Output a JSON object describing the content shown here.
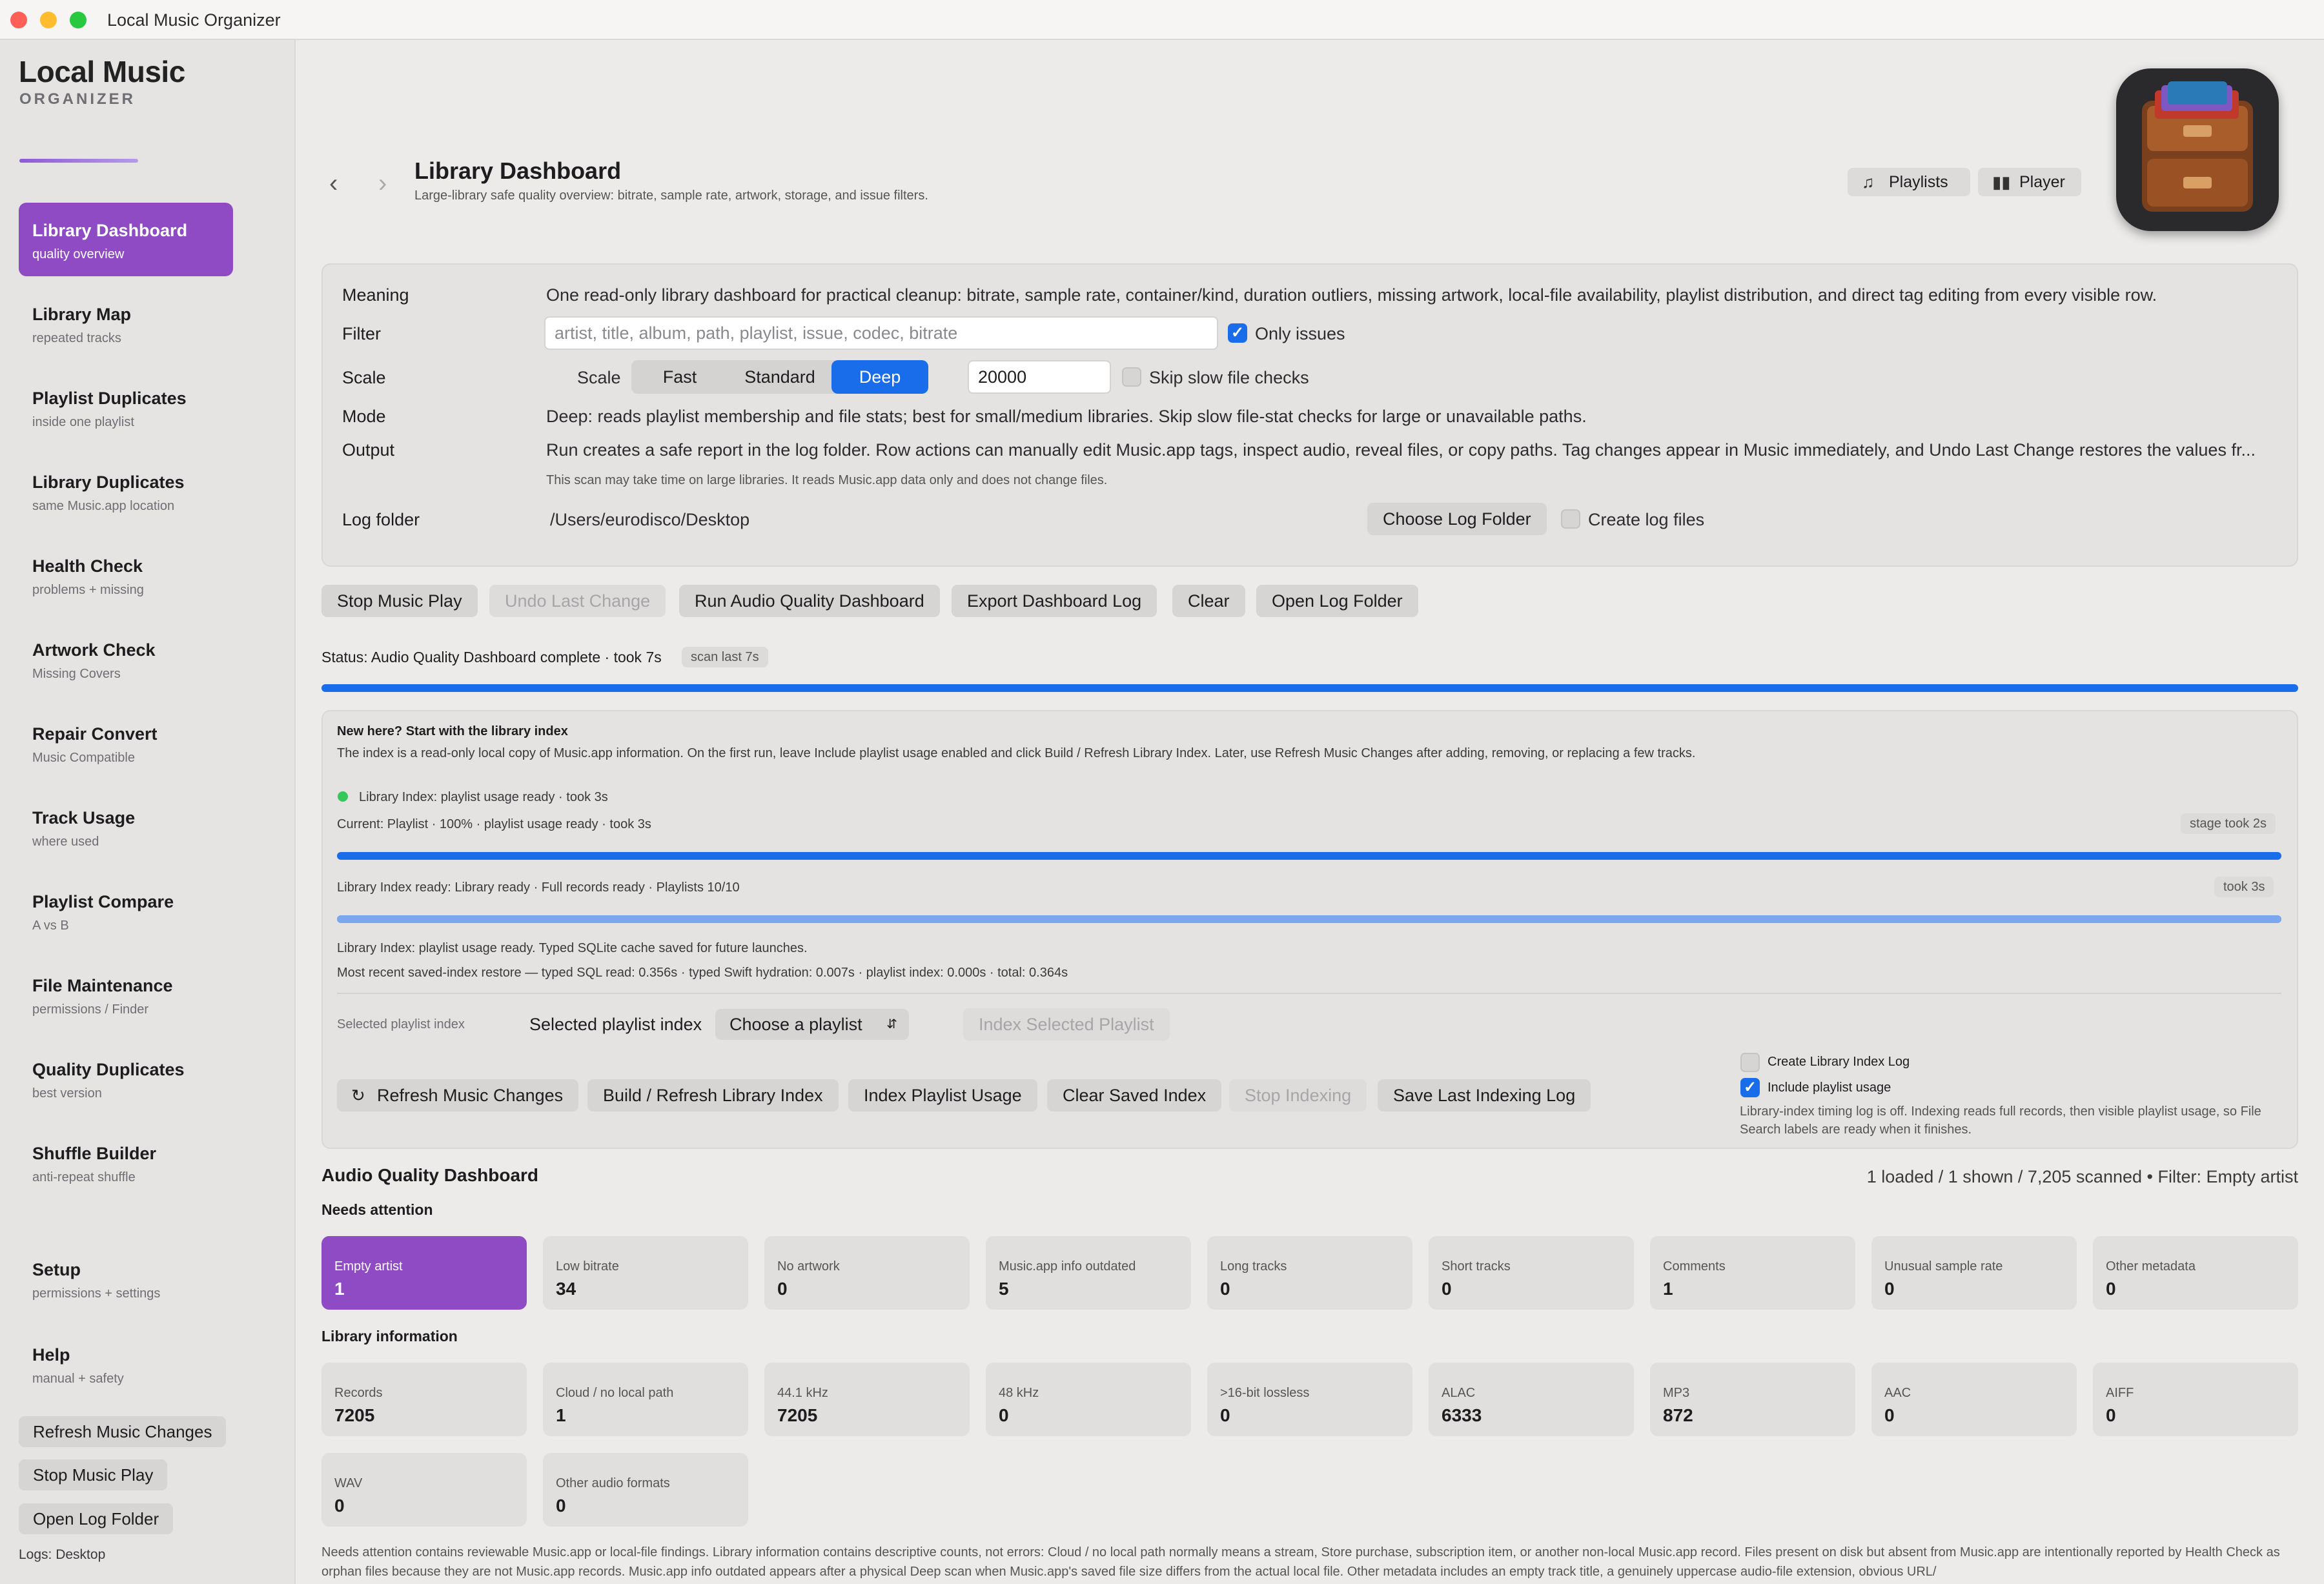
{
  "window": {
    "title": "Local Music Organizer"
  },
  "brand": {
    "line1": "Local Music",
    "line2": "ORGANIZER"
  },
  "sidebar": {
    "items": [
      {
        "title": "Library Dashboard",
        "sub": "quality overview"
      },
      {
        "title": "Library Map",
        "sub": "repeated tracks"
      },
      {
        "title": "Playlist Duplicates",
        "sub": "inside one playlist"
      },
      {
        "title": "Library Duplicates",
        "sub": "same Music.app location"
      },
      {
        "title": "Health Check",
        "sub": "problems + missing"
      },
      {
        "title": "Artwork Check",
        "sub": "Missing Covers"
      },
      {
        "title": "Repair Convert",
        "sub": "Music Compatible"
      },
      {
        "title": "Track Usage",
        "sub": "where used"
      },
      {
        "title": "Playlist Compare",
        "sub": "A vs B"
      },
      {
        "title": "File Maintenance",
        "sub": "permissions / Finder"
      },
      {
        "title": "Quality Duplicates",
        "sub": "best version"
      },
      {
        "title": "Shuffle Builder",
        "sub": "anti-repeat shuffle"
      },
      {
        "title": "Setup",
        "sub": "permissions + settings"
      },
      {
        "title": "Help",
        "sub": "manual + safety"
      }
    ],
    "buttons": {
      "refresh": "Refresh Music Changes",
      "stop": "Stop Music Play",
      "open_log": "Open Log Folder"
    },
    "logs": "Logs: Desktop"
  },
  "header": {
    "title": "Library Dashboard",
    "subtitle": "Large-library safe quality overview: bitrate, sample rate, artwork, storage, and issue filters.",
    "playlists_btn": "Playlists",
    "player_btn": "Player"
  },
  "settings": {
    "meaning_label": "Meaning",
    "meaning_text": "One read-only library dashboard for practical cleanup: bitrate, sample rate, container/kind, duration outliers, missing artwork, local-file availability, playlist distribution, and direct tag editing from every visible row.",
    "filter_label": "Filter",
    "filter_placeholder": "artist, title, album, path, playlist, issue, codec, bitrate",
    "only_issues": "Only issues",
    "scale_label": "Scale",
    "scale_inner": "Scale",
    "scale_options": [
      "Fast",
      "Standard",
      "Deep"
    ],
    "scale_selected": "Deep",
    "limit_value": "20000",
    "skip_slow": "Skip slow file checks",
    "mode_label": "Mode",
    "mode_text": "Deep: reads playlist membership and file stats; best for small/medium libraries. Skip slow file-stat checks for large or unavailable paths.",
    "output_label": "Output",
    "output_text": "Run creates a safe report in the log folder. Row actions can manually edit Music.app tags, inspect audio, reveal files, or copy paths. Tag changes appear in Music immediately, and Undo Last Change restores the values fr...",
    "scan_note": "This scan may take time on large libraries. It reads Music.app data only and does not change files.",
    "log_folder_label": "Log folder",
    "log_folder_path": "/Users/eurodisco/Desktop",
    "choose_log": "Choose Log Folder",
    "create_log": "Create log files"
  },
  "actions": {
    "stop": "Stop Music Play",
    "undo": "Undo Last Change",
    "run": "Run Audio Quality Dashboard",
    "export": "Export Dashboard Log",
    "clear": "Clear",
    "open_log": "Open Log Folder"
  },
  "status": {
    "text": "Status: Audio Quality Dashboard complete · took 7s",
    "pill": "scan last 7s",
    "progress": 1.0
  },
  "index": {
    "heading": "New here? Start with the library index",
    "intro": "The index is a read-only local copy of Music.app information. On the first run, leave Include playlist usage enabled and click Build / Refresh Library Index. Later, use Refresh Music Changes after adding, removing, or replacing a few tracks.",
    "state": "Library Index: playlist usage ready · took 3s",
    "current": "Current: Playlist · 100% · playlist usage ready · took 3s",
    "stage_pill": "stage took 2s",
    "ready": "Library Index ready: Library ready · Full records ready · Playlists 10/10",
    "took_pill": "took 3s",
    "cache_note": "Library Index: playlist usage ready. Typed SQLite cache saved for future launches.",
    "restore_note": "Most recent saved-index restore — typed SQL read: 0.356s · typed Swift hydration: 0.007s · playlist index: 0.000s · total: 0.364s",
    "selected_label_small": "Selected playlist index",
    "selected_label": "Selected playlist index",
    "select_value": "Choose a playlist",
    "index_selected": "Index Selected Playlist",
    "buttons": {
      "refresh": "Refresh Music Changes",
      "build": "Build / Refresh Library Index",
      "playlist_usage": "Index Playlist Usage",
      "clear_saved": "Clear Saved Index",
      "stop": "Stop Indexing",
      "save_log": "Save Last Indexing Log"
    },
    "create_index_log": "Create Library Index Log",
    "include_playlist": "Include playlist usage",
    "timing_note": "Library-index timing log is off. Indexing reads full records, then visible playlist usage, so File Search labels are ready when it finishes.",
    "current_progress": 1.0,
    "ready_progress": 1.0
  },
  "dashboard": {
    "title": "Audio Quality Dashboard",
    "summary": "1 loaded / 1 shown / 7,205 scanned • Filter: Empty artist",
    "needs_attention": "Needs attention",
    "attention_cards": [
      {
        "label": "Empty artist",
        "value": "1"
      },
      {
        "label": "Low bitrate",
        "value": "34"
      },
      {
        "label": "No artwork",
        "value": "0"
      },
      {
        "label": "Music.app info outdated",
        "value": "5"
      },
      {
        "label": "Long tracks",
        "value": "0"
      },
      {
        "label": "Short tracks",
        "value": "0"
      },
      {
        "label": "Comments",
        "value": "1"
      },
      {
        "label": "Unusual sample rate",
        "value": "0"
      },
      {
        "label": "Other metadata",
        "value": "0"
      }
    ],
    "library_information": "Library information",
    "info_cards": [
      {
        "label": "Records",
        "value": "7205"
      },
      {
        "label": "Cloud / no local path",
        "value": "1"
      },
      {
        "label": "44.1 kHz",
        "value": "7205"
      },
      {
        "label": "48 kHz",
        "value": "0"
      },
      {
        "label": ">16-bit lossless",
        "value": "0"
      },
      {
        "label": "ALAC",
        "value": "6333"
      },
      {
        "label": "MP3",
        "value": "872"
      },
      {
        "label": "AAC",
        "value": "0"
      },
      {
        "label": "AIFF",
        "value": "0"
      },
      {
        "label": "WAV",
        "value": "0"
      },
      {
        "label": "Other audio formats",
        "value": "0"
      }
    ],
    "footnote": "Needs attention contains reviewable Music.app or local-file findings. Library information contains descriptive counts, not errors: Cloud / no local path normally means a stream, Store purchase, subscription item, or another non-local Music.app record. Files present on disk but absent from Music.app are intentionally reported by Health Check as orphan files because they are not Music.app records. Music.app info outdated appears after a physical Deep scan when Music.app's saved file size differs from the actual local file. Other metadata includes an empty track title, a genuinely uppercase audio-file extension, obvious URL/"
  },
  "colors": {
    "accent": "#1a6dea",
    "purple": "#8e4bc4",
    "green": "#34c759"
  }
}
